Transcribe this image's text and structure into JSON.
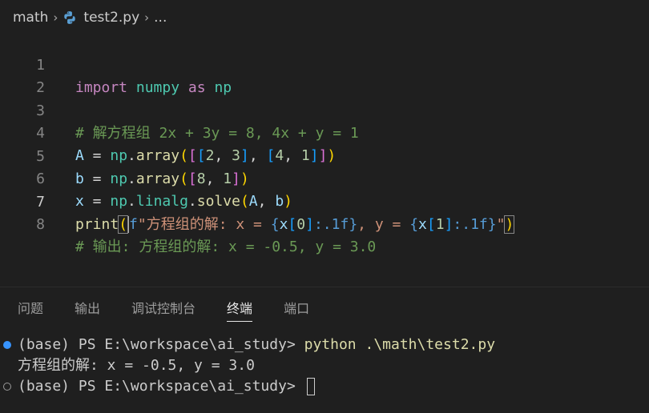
{
  "breadcrumb": {
    "folder": "math",
    "file": "test2.py",
    "more": "..."
  },
  "editor": {
    "active_line": 7,
    "lines": [
      {
        "n": "1"
      },
      {
        "n": "2"
      },
      {
        "n": "3"
      },
      {
        "n": "4"
      },
      {
        "n": "5"
      },
      {
        "n": "6"
      },
      {
        "n": "7"
      },
      {
        "n": "8"
      }
    ],
    "tokens": {
      "l1_import": "import",
      "l1_numpy": "numpy",
      "l1_as": "as",
      "l1_np": "np",
      "l3_comment": "# 解方程组 2x + 3y = 8, 4x + y = 1",
      "l4_A": "A",
      "l4_eq": " = ",
      "l4_np": "np",
      "l4_dot": ".",
      "l4_array": "array",
      "l4_p1": "(",
      "l4_b1": "[",
      "l4_b2": "[",
      "l4_n1": "2",
      "l4_c1": ", ",
      "l4_n2": "3",
      "l4_b3": "]",
      "l4_c2": ", ",
      "l4_b4": "[",
      "l4_n3": "4",
      "l4_c3": ", ",
      "l4_n4": "1",
      "l4_b5": "]",
      "l4_b6": "]",
      "l4_p2": ")",
      "l5_b": "b",
      "l5_eq": " = ",
      "l5_np": "np",
      "l5_dot": ".",
      "l5_array": "array",
      "l5_p1": "(",
      "l5_b1": "[",
      "l5_n1": "8",
      "l5_c1": ", ",
      "l5_n2": "1",
      "l5_b2": "]",
      "l5_p2": ")",
      "l6_x": "x",
      "l6_eq": " = ",
      "l6_np": "np",
      "l6_dot1": ".",
      "l6_linalg": "linalg",
      "l6_dot2": ".",
      "l6_solve": "solve",
      "l6_p1": "(",
      "l6_A": "A",
      "l6_c": ", ",
      "l6_b": "b",
      "l6_p2": ")",
      "l7_print": "print",
      "l7_p1": "(",
      "l7_f": "f",
      "l7_s1": "\"方程组的解: x = ",
      "l7_o1": "{",
      "l7_x1": "x",
      "l7_k1": "[",
      "l7_i1": "0",
      "l7_k2": "]",
      "l7_fmt1": ":.1f",
      "l7_c1": "}",
      "l7_s2": ", y = ",
      "l7_o2": "{",
      "l7_x2": "x",
      "l7_k3": "[",
      "l7_i2": "1",
      "l7_k4": "]",
      "l7_fmt2": ":.1f",
      "l7_c2": "}",
      "l7_s3": "\"",
      "l7_p2": ")",
      "l8_comment": "# 输出: 方程组的解: x = -0.5, y = 3.0"
    }
  },
  "panel": {
    "tabs": [
      "问题",
      "输出",
      "调试控制台",
      "终端",
      "端口"
    ],
    "active_tab": "终端"
  },
  "terminal": {
    "prompt1": "(base) PS E:\\workspace\\ai_study> ",
    "command1": "python .\\math\\test2.py",
    "output1": "方程组的解: x = -0.5, y = 3.0",
    "prompt2": "(base) PS E:\\workspace\\ai_study> "
  },
  "colors": {
    "background": "#1f1f1f",
    "keyword": "#c586c0",
    "variable": "#9cdcfe",
    "namespace": "#4ec9b0",
    "function": "#dcdcaa",
    "number": "#b5cea8",
    "comment": "#6a9955",
    "string": "#ce9178",
    "accent": "#3794ff"
  }
}
